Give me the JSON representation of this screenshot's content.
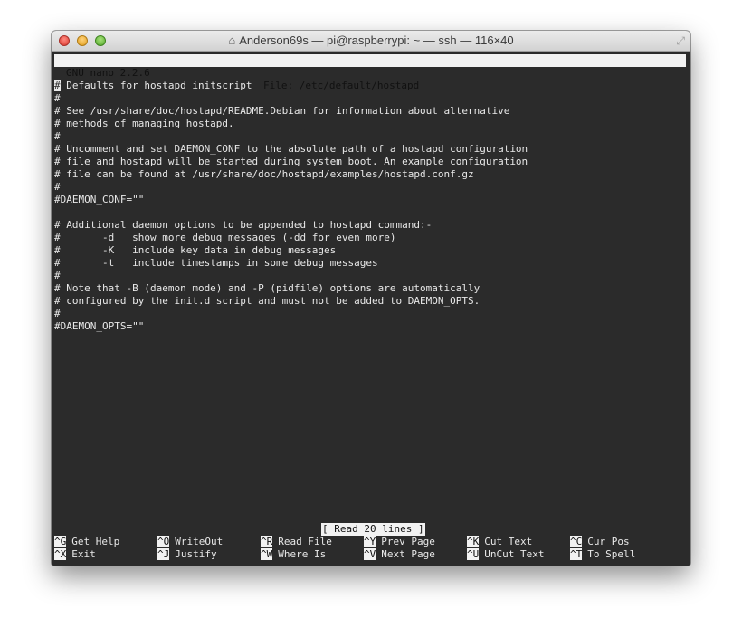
{
  "window": {
    "title": "Anderson69s — pi@raspberrypi: ~ — ssh — 116×40",
    "title_icon": "home-icon"
  },
  "nano": {
    "version": "GNU nano 2.2.6",
    "file": "File: /etc/default/hostapd",
    "status": "[ Read 20 lines ]"
  },
  "content_lines": [
    "# Defaults for hostapd initscript",
    "#",
    "# See /usr/share/doc/hostapd/README.Debian for information about alternative",
    "# methods of managing hostapd.",
    "#",
    "# Uncomment and set DAEMON_CONF to the absolute path of a hostapd configuration",
    "# file and hostapd will be started during system boot. An example configuration",
    "# file can be found at /usr/share/doc/hostapd/examples/hostapd.conf.gz",
    "#",
    "#DAEMON_CONF=\"\"",
    "",
    "# Additional daemon options to be appended to hostapd command:-",
    "#       -d   show more debug messages (-dd for even more)",
    "#       -K   include key data in debug messages",
    "#       -t   include timestamps in some debug messages",
    "#",
    "# Note that -B (daemon mode) and -P (pidfile) options are automatically",
    "# configured by the init.d script and must not be added to DAEMON_OPTS.",
    "#",
    "#DAEMON_OPTS=\"\""
  ],
  "shortcuts": {
    "row1": [
      {
        "key": "^G",
        "label": "Get Help"
      },
      {
        "key": "^O",
        "label": "WriteOut"
      },
      {
        "key": "^R",
        "label": "Read File"
      },
      {
        "key": "^Y",
        "label": "Prev Page"
      },
      {
        "key": "^K",
        "label": "Cut Text"
      },
      {
        "key": "^C",
        "label": "Cur Pos"
      }
    ],
    "row2": [
      {
        "key": "^X",
        "label": "Exit"
      },
      {
        "key": "^J",
        "label": "Justify"
      },
      {
        "key": "^W",
        "label": "Where Is"
      },
      {
        "key": "^V",
        "label": "Next Page"
      },
      {
        "key": "^U",
        "label": "UnCut Text"
      },
      {
        "key": "^T",
        "label": "To Spell"
      }
    ]
  },
  "colors": {
    "terminal_bg": "#2b2b2b",
    "terminal_fg": "#e8e8e8",
    "highlight_bg": "#f2f2f2"
  }
}
